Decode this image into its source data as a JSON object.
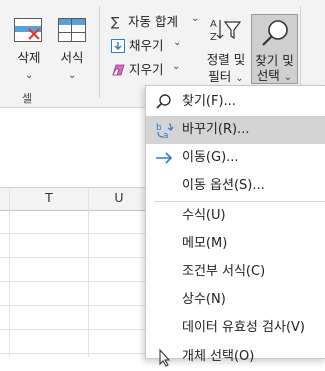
{
  "ribbon": {
    "delete_label": "삭제",
    "format_label": "서식",
    "cells_group_label": "셀",
    "autosum_label": "자동 합계",
    "fill_label": "채우기",
    "clear_label": "지우기",
    "sort_filter_line1": "정렬 및",
    "sort_filter_line2": "필터",
    "find_select_line1": "찾기 및",
    "find_select_line2": "선택"
  },
  "sheet": {
    "columns": [
      "T",
      "U"
    ]
  },
  "menu": {
    "items": [
      {
        "label": "찾기(F)...",
        "icon": "search-icon"
      },
      {
        "label": "바꾸기(R)...",
        "icon": "replace-icon"
      },
      {
        "label": "이동(G)...",
        "icon": "arrow-right-icon"
      },
      {
        "label": "이동 옵션(S)..."
      },
      {
        "label": "수식(U)"
      },
      {
        "label": "메모(M)"
      },
      {
        "label": "조건부 서식(C)"
      },
      {
        "label": "상수(N)"
      },
      {
        "label": "데이터 유효성 검사(V)"
      },
      {
        "label": "개체 선택(O)"
      }
    ],
    "hovered_index": 1
  },
  "colors": {
    "accent": "#2b7cd3",
    "hover": "#d4d4d4"
  }
}
